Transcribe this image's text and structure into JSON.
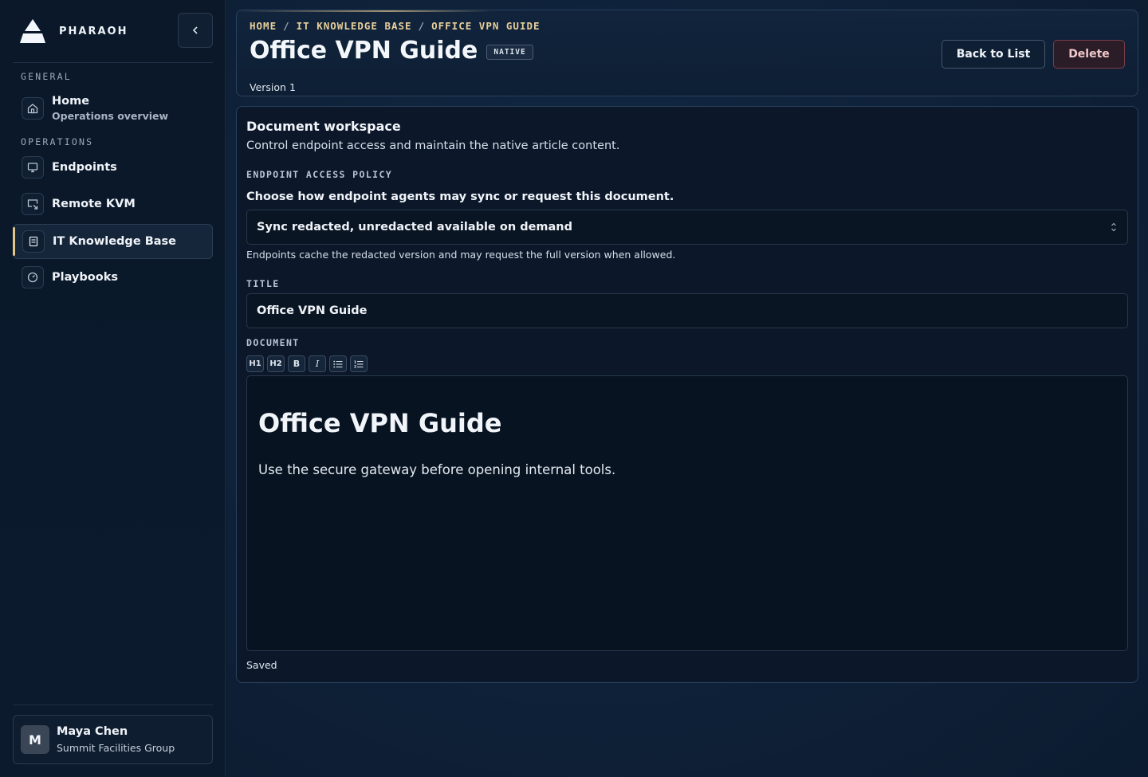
{
  "brand": {
    "name": "PHARAOH"
  },
  "sidebar": {
    "sections": [
      {
        "label": "GENERAL"
      },
      {
        "label": "OPERATIONS"
      }
    ],
    "items": [
      {
        "label": "Home",
        "sub": "Operations overview",
        "icon": "home-icon"
      },
      {
        "label": "Endpoints",
        "icon": "monitor-icon"
      },
      {
        "label": "Remote KVM",
        "icon": "remote-screen-icon"
      },
      {
        "label": "IT Knowledge Base",
        "icon": "book-icon",
        "active": true
      },
      {
        "label": "Playbooks",
        "icon": "gauge-icon"
      }
    ],
    "collapse_icon": "chevron-left-icon"
  },
  "user": {
    "initial": "M",
    "name": "Maya Chen",
    "org": "Summit Facilities Group"
  },
  "header": {
    "breadcrumb": [
      "HOME",
      "IT KNOWLEDGE BASE",
      "OFFICE VPN GUIDE"
    ],
    "breadcrumb_sep": "/",
    "title": "Office VPN Guide",
    "badge": "NATIVE",
    "version": "Version 1",
    "back_label": "Back to List",
    "delete_label": "Delete"
  },
  "workspace": {
    "title": "Document workspace",
    "subtitle": "Control endpoint access and maintain the native article content.",
    "policy_label": "ENDPOINT ACCESS POLICY",
    "policy_question": "Choose how endpoint agents may sync or request this document.",
    "policy_value": "Sync redacted, unredacted available on demand",
    "policy_help": "Endpoints cache the redacted version and may request the full version when allowed.",
    "title_label": "TITLE",
    "title_value": "Office VPN Guide",
    "document_label": "DOCUMENT",
    "toolbar": [
      {
        "glyph": "H1",
        "name": "heading-1-button"
      },
      {
        "glyph": "H2",
        "name": "heading-2-button"
      },
      {
        "glyph": "B",
        "name": "bold-button"
      },
      {
        "glyph": "I",
        "name": "italic-button"
      },
      {
        "glyph": "≔",
        "name": "bullet-list-button"
      },
      {
        "glyph": "⒈",
        "name": "numbered-list-button"
      }
    ],
    "editor_heading": "Office VPN Guide",
    "editor_paragraph": "Use the secure gateway before opening internal tools.",
    "status": "Saved"
  },
  "colors": {
    "accent": "#e3c58a",
    "danger": "#7b3e48",
    "bg": "#0c1a2c"
  }
}
